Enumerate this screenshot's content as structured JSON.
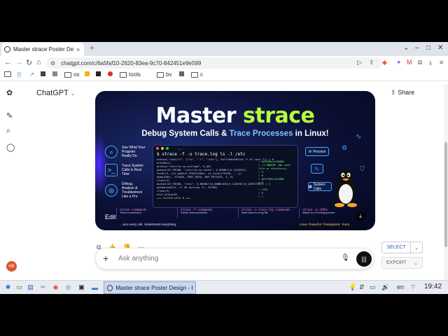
{
  "browser": {
    "tab_title": "Master strace Poster De",
    "tab_close": "×",
    "new_tab": "+",
    "window_controls": [
      "⌄",
      "–",
      "□",
      "✕"
    ],
    "url": "chatgpt.com/c/6a5faf10-2620-83ea-9c70-842451e9e599",
    "bookmarks": [
      "os",
      "tools",
      "bv",
      "c"
    ]
  },
  "app": {
    "title": "ChatGPT",
    "share_label": "Share",
    "composer_placeholder": "Ask anything",
    "avatar_initials": "HB"
  },
  "poster": {
    "title_part1": "Master",
    "title_part2": "strace",
    "subtitle_part1": "Debug System Calls &",
    "subtitle_part2": "Trace Processes",
    "subtitle_part3": "in Linux!",
    "features": [
      {
        "text": "See What Your Program Really Do"
      },
      {
        "text": "Trace System Calls in Real Time"
      },
      {
        "text": "Debug, Analyze & Troubleshoot Like a Pro"
      }
    ],
    "terminal_title": ">_ ~",
    "terminal_prompt": "$ strace -f -o trace.log ls -l /etc",
    "terminal_lines": [
      "execve(\"/bin/ls\", [\"ls\", \"-l\", \"/etc\"], 0x7ffe8a34bfc0 /* 61 vars */) = 0",
      "brk(NULL)",
      "access(\"/etc/ld.so.preload\", R_OK)",
      "openat(AT_FDCWD, \"/etc/ld.so.cache\", O_RDONLY|O_CLOEXEC)",
      "fstat(3, {st_mode=S_IFREG|0644, st_size=173456, ...})",
      "mmap(NULL, 123456, PROT_READ, MAP_PRIVATE, 3, 0)",
      "close(3)",
      "openat(AT_FDCWD, \"/etc\", O_RDONLY|O_NONBLOCK|O_CLOEXEC|O_DIRECTORY) = 3",
      "getdents64(3, /* 36 entries */, 32768)",
      "close(3)",
      "exit_group(0)",
      "+++ exited with 0 +++"
    ],
    "terminal_results": [
      "= 0x5566ccc30000",
      "= -1 ENOENT (No such file or directory)",
      "= 3",
      "= 0",
      "= 0x7f9d5c1a1000",
      "= 0",
      "",
      "= 1152",
      "= 0",
      "= ?"
    ],
    "right_boxes": [
      "Process",
      "System Calls"
    ],
    "strip": [
      {
        "cmd": "strace <command>",
        "desc": "Trace a command"
      },
      {
        "cmd": "strace -f <command>",
        "desc": "Follow child processes"
      },
      {
        "cmd": "strace -o trace.log <command>",
        "desc": "Save trace to a log file"
      },
      {
        "cmd": "strace -p <PID>",
        "desc": "Attach to a running process"
      }
    ],
    "footer_left": "...ace every call. Understand everything.",
    "footer_right": "Linux. Powerful. Transparent. Yours.",
    "edit_label": "Edit"
  },
  "extension": {
    "select_label": "SELECT",
    "export_label": "EXPORT"
  },
  "taskbar": {
    "task_label": "Master strace Poster Design - B...",
    "lang": "en",
    "clock": "19:42"
  }
}
